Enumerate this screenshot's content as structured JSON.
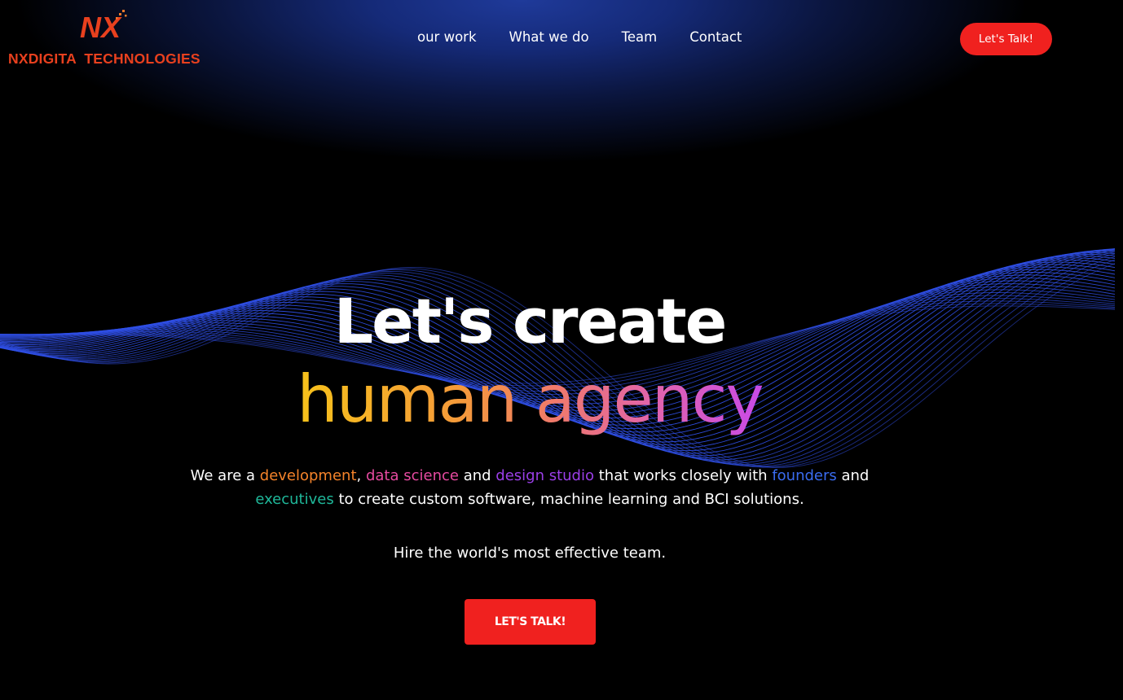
{
  "brand": {
    "mark": "NX",
    "name": "NXDIGITA  TECHNOLOGIES",
    "color": "#e8401e"
  },
  "nav": {
    "items": [
      {
        "label": "our work"
      },
      {
        "label": "What we do"
      },
      {
        "label": "Team"
      },
      {
        "label": "Contact"
      }
    ],
    "cta_label": "Let's Talk!"
  },
  "hero": {
    "headline_line1": "Let's create",
    "headline_line2": "human agency",
    "description": {
      "p1": "We are a ",
      "hl1": "development",
      "p2": ", ",
      "hl2": "data science",
      "p3": " and ",
      "hl3": "design studio",
      "p4": " that works closely with ",
      "hl4": "founders",
      "p5": " and ",
      "hl5": "executives",
      "p6": " to create custom software, machine learning and BCI solutions."
    },
    "tagline": "Hire the world's most effective team.",
    "cta_label": "LET'S TALK!"
  },
  "colors": {
    "accent_red": "#f0211f",
    "development": "#f5832a",
    "data_science": "#e64aa0",
    "design_studio": "#9b3fe8",
    "founders": "#3a6cf0",
    "executives": "#1fb89a",
    "wave": "#2f4fe6"
  }
}
